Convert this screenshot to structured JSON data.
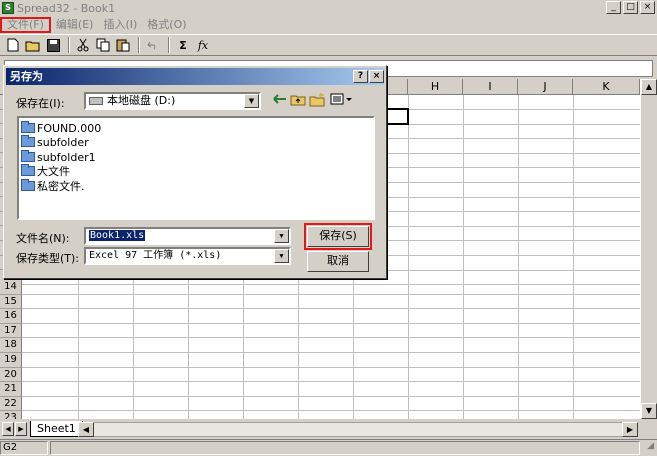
{
  "window": {
    "title": "Spread32 - Book1",
    "buttons": {
      "minimize": "_",
      "maximize": "□",
      "close": "×"
    }
  },
  "menu": {
    "items": [
      {
        "label": "文件(F)"
      },
      {
        "label": "编辑(E)"
      },
      {
        "label": "插入(I)"
      },
      {
        "label": "格式(O)"
      }
    ]
  },
  "toolbar": {
    "sum_label": "Σ",
    "fx_label": "fx"
  },
  "grid": {
    "columns": [
      "H",
      "I",
      "J",
      "K"
    ],
    "rows": [
      "14",
      "15",
      "16",
      "17",
      "18",
      "19",
      "20",
      "21",
      "22",
      "23"
    ]
  },
  "sheets": {
    "tabs": [
      "Sheet1"
    ]
  },
  "status": {
    "cell_ref": "G2"
  },
  "dialog": {
    "title": "另存为",
    "help_button": "?",
    "close_button": "×",
    "save_in_label": "保存在(I):",
    "save_in_value": "本地磁盘 (D:)",
    "files": [
      {
        "name": "FOUND.000"
      },
      {
        "name": "subfolder"
      },
      {
        "name": "subfolder1"
      },
      {
        "name": "大文件"
      },
      {
        "name": "私密文件."
      }
    ],
    "filename_label": "文件名(N):",
    "filename_value": "Book1.xls",
    "filetype_label": "保存类型(T):",
    "filetype_value": "Excel 97 工作簿 (*.xls)",
    "save_button": "保存(S)",
    "cancel_button": "取消"
  },
  "colors": {
    "highlight": "#e01818",
    "dialog_title_start": "#0a246a",
    "dialog_title_end": "#a6caf0"
  }
}
